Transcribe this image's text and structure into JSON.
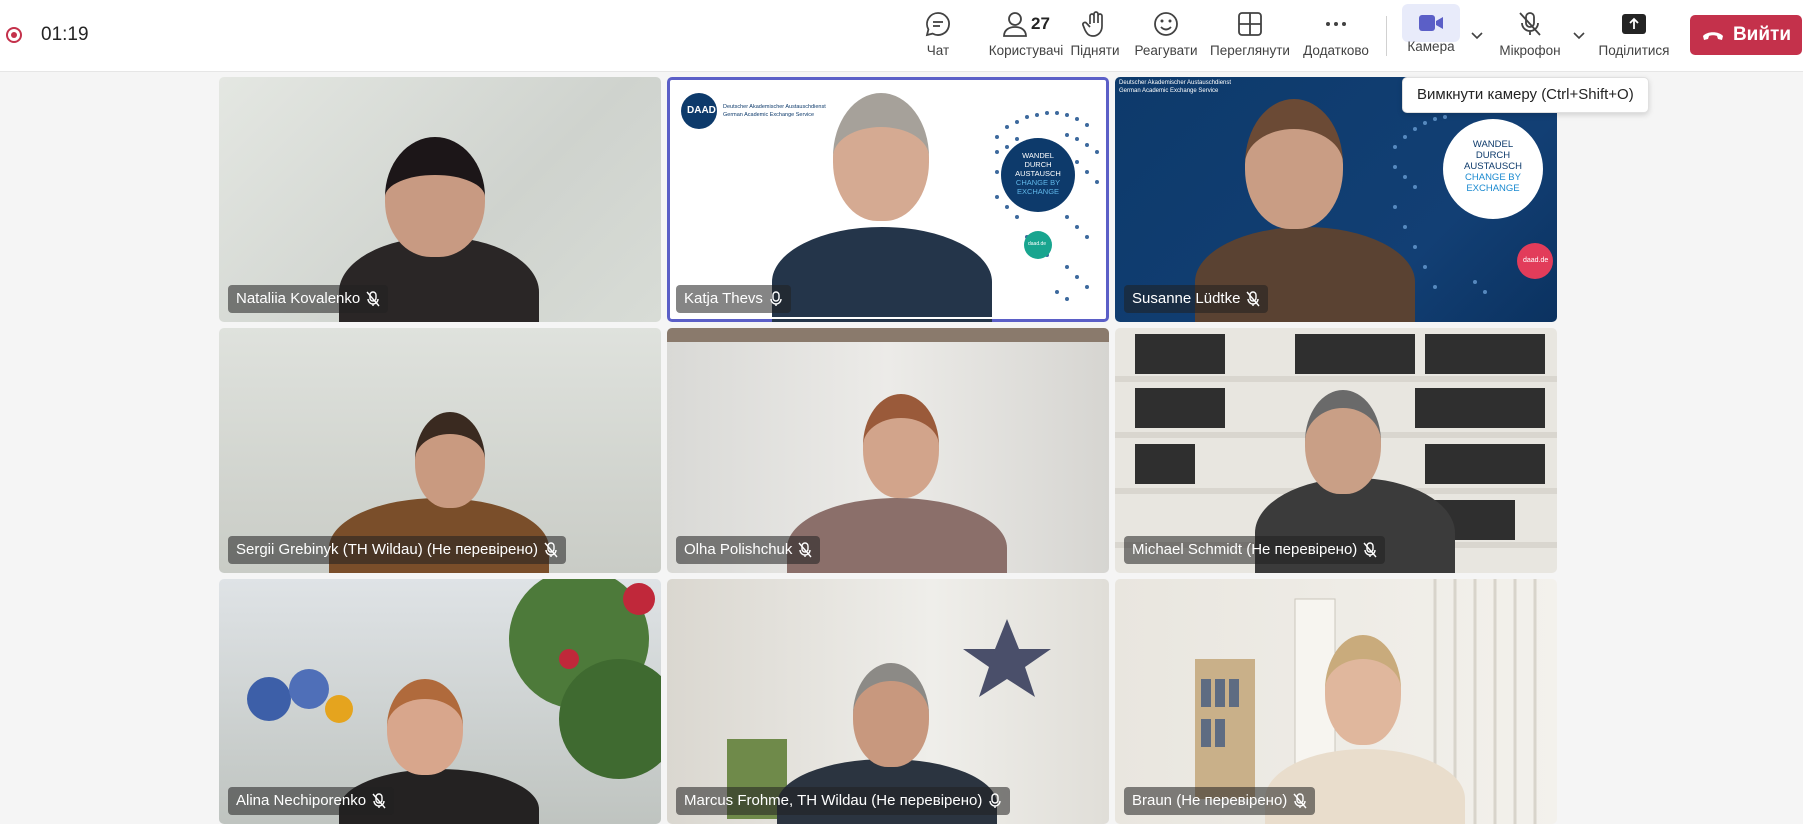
{
  "recording": {
    "time": "01:19"
  },
  "toolbar": {
    "chat": "Чат",
    "people": "Користувачі",
    "people_count": "27",
    "raise": "Підняти",
    "react": "Реагувати",
    "view": "Переглянути",
    "more": "Додатково",
    "camera": "Камера",
    "mic": "Мікрофон",
    "share": "Поділитися",
    "leave": "Вийти"
  },
  "tooltip": {
    "text": "Вимкнути камеру (Ctrl+Shift+O)"
  },
  "participants": [
    {
      "name": "Nataliia Kovalenko",
      "muted": true
    },
    {
      "name": "Katja Thevs",
      "muted": false,
      "speaking": true
    },
    {
      "name": "Susanne Lüdtke",
      "muted": true
    },
    {
      "name": "Sergii Grebinyk (TH Wildau) (Не перевірено)",
      "muted": true
    },
    {
      "name": "Olha Polishchuk",
      "muted": true
    },
    {
      "name": "Michael Schmidt (Не перевірено)",
      "muted": true
    },
    {
      "name": "Alina Nechiporenko",
      "muted": true
    },
    {
      "name": "Marcus Frohme, TH Wildau (Не перевірено)",
      "muted": false
    },
    {
      "name": "Braun (Не перевірено)",
      "muted": true
    }
  ],
  "daad": {
    "org_de": "Deutscher Akademischer Austauschdienst",
    "org_en": "German Academic Exchange Service",
    "slogan_de_1": "WANDEL",
    "slogan_de_2": "DURCH",
    "slogan_de_3": "AUSTAUSCH",
    "slogan_en_1": "CHANGE BY",
    "slogan_en_2": "EXCHANGE",
    "logo": "DAAD",
    "url": "daad.de"
  },
  "colors": {
    "accent": "#5b5fc7",
    "leave": "#c4314b",
    "daad_blue": "#0d3a6b"
  }
}
